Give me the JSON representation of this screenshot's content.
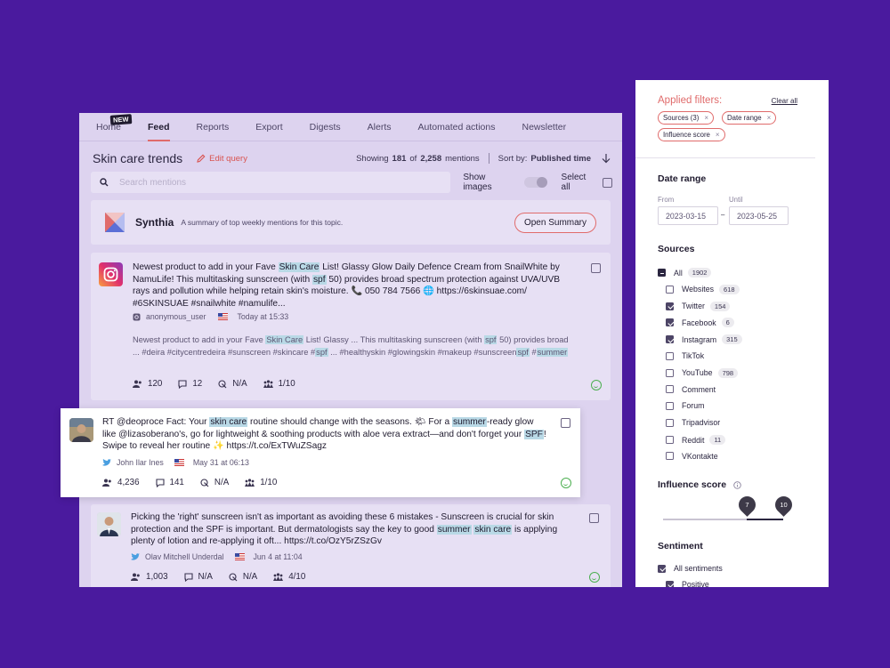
{
  "nav": {
    "items": [
      "Home",
      "Feed",
      "Reports",
      "Export",
      "Digests",
      "Alerts",
      "Automated actions",
      "Newsletter"
    ],
    "new_badge": "NEW",
    "active": "Feed"
  },
  "header": {
    "title": "Skin care trends",
    "edit_query": "Edit query",
    "showing_prefix": "Showing",
    "showing_count": "181",
    "showing_of": "of",
    "showing_total": "2,258",
    "showing_suffix": "mentions",
    "sort_label": "Sort by:",
    "sort_value": "Published time"
  },
  "search": {
    "placeholder": "Search mentions",
    "show_images": "Show images",
    "select_all": "Select all"
  },
  "synthia": {
    "name": "Synthia",
    "description": "A summary of top weekly mentions for this topic.",
    "button": "Open Summary"
  },
  "mentions": [
    {
      "source_icon": "instagram-icon",
      "text_parts": [
        "Newest product to add in your Fave ",
        "Skin Care",
        " List! Glassy Glow Daily Defence Cream from SnailWhite by NamuLife! This multitasking sunscreen (with ",
        "spf",
        " 50) provides broad spectrum protection against UVA/UVB rays and pollution while helping retain skin's moisture. 📞 050 784 7566 🌐 https://6skinsuae.com/ #6SKINSUAE #snailwhite #namulife..."
      ],
      "author": "anonymous_user",
      "time": "Today at 15:33",
      "snippet_parts": [
        "Newest product to add in your Fave ",
        "Skin Care",
        " List! Glassy ... This multitasking sunscreen (with ",
        "spf",
        " 50) provides broad ... #deira #citycentredeira #sunscreen #skincare #",
        "spf",
        " ... #healthyskin #glowingskin #makeup #sunscreen",
        "spf",
        " #",
        "summer"
      ],
      "reach": "120",
      "comments": "12",
      "engagement": "N/A",
      "influence": "1/10"
    },
    {
      "source_icon": "twitter-icon",
      "text_parts": [
        "RT @deoproce Fact: Your ",
        "skin care",
        " routine should change with the seasons. 🌤 For a ",
        "summer",
        "-ready glow like @lizasoberano's, go for lightweight & soothing products with aloe vera extract—and don't forget your ",
        "SPF",
        "! Swipe to reveal her routine ✨ https://t.co/ExTWuZSagz"
      ],
      "author": "John Ilar Ines",
      "time": "May 31 at 06:13",
      "reach": "4,236",
      "comments": "141",
      "engagement": "N/A",
      "influence": "1/10"
    },
    {
      "source_icon": "twitter-icon",
      "text_parts": [
        "Picking the 'right' sunscreen isn't as important as avoiding these 6 mistakes - Sunscreen is crucial for skin protection and the SPF is important. But dermatologists say the key to good ",
        "summer",
        " ",
        "skin care",
        " is applying plenty of lotion and re-applying it oft... https://t.co/OzY5rZSzGv"
      ],
      "author": "Olav Mitchell Underdal",
      "time": "Jun 4 at 11:04",
      "reach": "1,003",
      "comments": "N/A",
      "engagement": "N/A",
      "influence": "4/10"
    }
  ],
  "filters": {
    "applied_title": "Applied filters:",
    "clear_all": "Clear all",
    "chips": [
      "Sources (3)",
      "Date range",
      "Influence score"
    ],
    "date_range": {
      "title": "Date range",
      "from_label": "From",
      "from": "2023-03-15",
      "to_label": "Until",
      "to": "2023-05-25"
    },
    "sources": {
      "title": "Sources",
      "items": [
        {
          "label": "All",
          "count": "1902",
          "state": "partial"
        },
        {
          "label": "Websites",
          "count": "618",
          "state": "unchecked"
        },
        {
          "label": "Twitter",
          "count": "154",
          "state": "checked"
        },
        {
          "label": "Facebook",
          "count": "6",
          "state": "checked"
        },
        {
          "label": "Instagram",
          "count": "315",
          "state": "checked"
        },
        {
          "label": "TikTok",
          "count": "",
          "state": "unchecked"
        },
        {
          "label": "YouTube",
          "count": "798",
          "state": "unchecked"
        },
        {
          "label": "Comment",
          "count": "",
          "state": "unchecked"
        },
        {
          "label": "Forum",
          "count": "",
          "state": "unchecked"
        },
        {
          "label": "Tripadvisor",
          "count": "",
          "state": "unchecked"
        },
        {
          "label": "Reddit",
          "count": "11",
          "state": "unchecked"
        },
        {
          "label": "VKontakte",
          "count": "",
          "state": "unchecked"
        }
      ]
    },
    "influence": {
      "title": "Influence score",
      "min": "7",
      "max": "10"
    },
    "sentiment": {
      "title": "Sentiment",
      "items": [
        {
          "label": "All sentiments",
          "state": "checked"
        },
        {
          "label": "Positive",
          "state": "checked"
        }
      ]
    }
  },
  "colors": {
    "background": "#4a1a9e",
    "accent": "#e06b6b",
    "highlight": "#b9d9e6",
    "positive": "#4caf50"
  }
}
